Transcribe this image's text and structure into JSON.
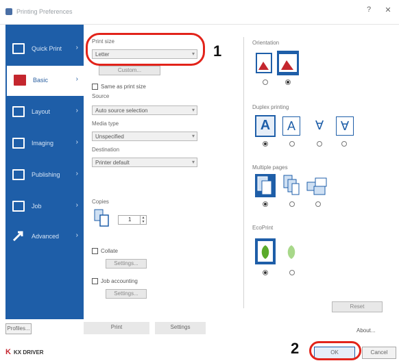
{
  "window": {
    "title": "Printing Preferences",
    "help_label": "?",
    "close_label": "✕"
  },
  "callouts": {
    "one": "1",
    "two": "2"
  },
  "sidebar": {
    "items": [
      {
        "label": "Quick Print",
        "icon": "quick-print-icon"
      },
      {
        "label": "Basic",
        "icon": "basic-icon"
      },
      {
        "label": "Layout",
        "icon": "layout-icon"
      },
      {
        "label": "Imaging",
        "icon": "imaging-icon"
      },
      {
        "label": "Publishing",
        "icon": "publishing-icon"
      },
      {
        "label": "Job",
        "icon": "job-icon"
      },
      {
        "label": "Advanced",
        "icon": "advanced-icon"
      }
    ],
    "active_index": 1,
    "colors": {
      "background": "#1e5ea8",
      "active_icon": "#c4262e"
    }
  },
  "basic": {
    "print_size_label": "Print size",
    "print_size_value": "Letter",
    "custom_button": "Custom...",
    "same_as_print_size_label": "Same as print size",
    "source_label": "Source",
    "source_value": "Auto source selection",
    "media_type_label": "Media type",
    "media_type_value": "Unspecified",
    "destination_label": "Destination",
    "destination_value": "Printer default",
    "copies_label": "Copies",
    "copies_value": "1",
    "collate_label": "Collate",
    "settings_button": "Settings...",
    "job_accounting_label": "Job accounting",
    "settings2_button": "Settings..."
  },
  "right": {
    "orientation_group": "Orientation",
    "duplex_group": "Duplex printing",
    "multiple_pages_group": "Multiple pages",
    "ecoprint_group": "EcoPrint",
    "reset_button": "Reset",
    "selections": {
      "orientation": 1,
      "duplex": 0,
      "multiple": 0,
      "ecoprint": 0
    }
  },
  "footer": {
    "profiles_button": "Profiles...",
    "print_button": "Print",
    "settings_button": "Settings",
    "about_button": "About...",
    "brand_label": "KX DRIVER",
    "ok_button": "OK",
    "cancel_button": "Cancel"
  }
}
